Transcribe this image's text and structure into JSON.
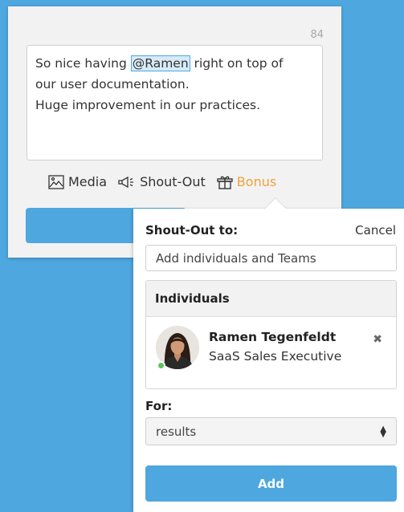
{
  "composer": {
    "char_count": "84",
    "message_before": "So nice having ",
    "mention": "@Ramen",
    "message_line1_after": " right on top of",
    "message_line2": "our user documentation.",
    "message_line3": "Huge improvement in our practices."
  },
  "toolbar": {
    "media_label": "Media",
    "media_icon": "image-icon",
    "shoutout_label": "Shout-Out",
    "shoutout_icon": "megaphone-icon",
    "bonus_label": "Bonus",
    "bonus_icon": "gift-icon",
    "bonus_color": "#f0a23a"
  },
  "shoutout_popover": {
    "title": "Shout-Out to:",
    "cancel_label": "Cancel",
    "recipient_value": "Add individuals and Teams",
    "individuals_header": "Individuals",
    "individuals": [
      {
        "name": "Ramen Tegenfeldt",
        "title": "SaaS Sales Executive",
        "status": "online"
      }
    ],
    "for_label": "For:",
    "reason_selected": "results",
    "add_label": "Add"
  },
  "colors": {
    "background": "#4ea7df",
    "accent": "#4ea7df",
    "presence_online": "#5cc45c"
  }
}
